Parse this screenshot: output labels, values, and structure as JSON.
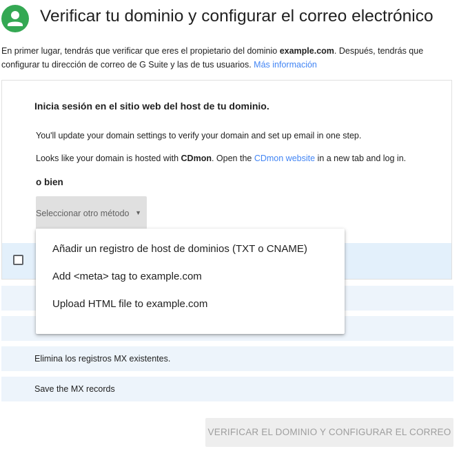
{
  "header": {
    "title": "Verificar tu dominio y configurar el correo electrónico"
  },
  "intro": {
    "part1": "En primer lugar, tendrás que verificar que eres el propietario del dominio ",
    "domain": "example.com",
    "part2": ". Después, tendrás que configurar tu dirección de correo de G Suite y las de tus usuarios. ",
    "link": "Más información"
  },
  "step": {
    "title": "Inicia sesión en el sitio web del host de tu dominio.",
    "line1": "You'll update your domain settings to verify your domain and set up email in one step.",
    "line2_part1": "Looks like your domain is hosted with ",
    "line2_host": "CDmon",
    "line2_part2": ". Open the ",
    "line2_link": "CDmon website",
    "line2_part3": " in a new tab and log in.",
    "or_label": "o bien",
    "select_label": "Seleccionar otro método",
    "select_arrow": "▼"
  },
  "dropdown": {
    "items": [
      "Añadir un registro de host de dominios (TXT o CNAME)",
      "Add <meta> tag to example.com",
      "Upload HTML file to example.com"
    ]
  },
  "checklist": {
    "row3": "Elimina los registros MX existentes.",
    "row4": "Save the MX records"
  },
  "actions": {
    "verify_label": "VERIFICAR EL DOMINIO Y CONFIGURAR EL CORREO"
  },
  "colors": {
    "avatar": "#34a853",
    "link": "#4285f4",
    "row_highlight": "#e3f0fb",
    "disabled_text": "#9e9e9e"
  }
}
